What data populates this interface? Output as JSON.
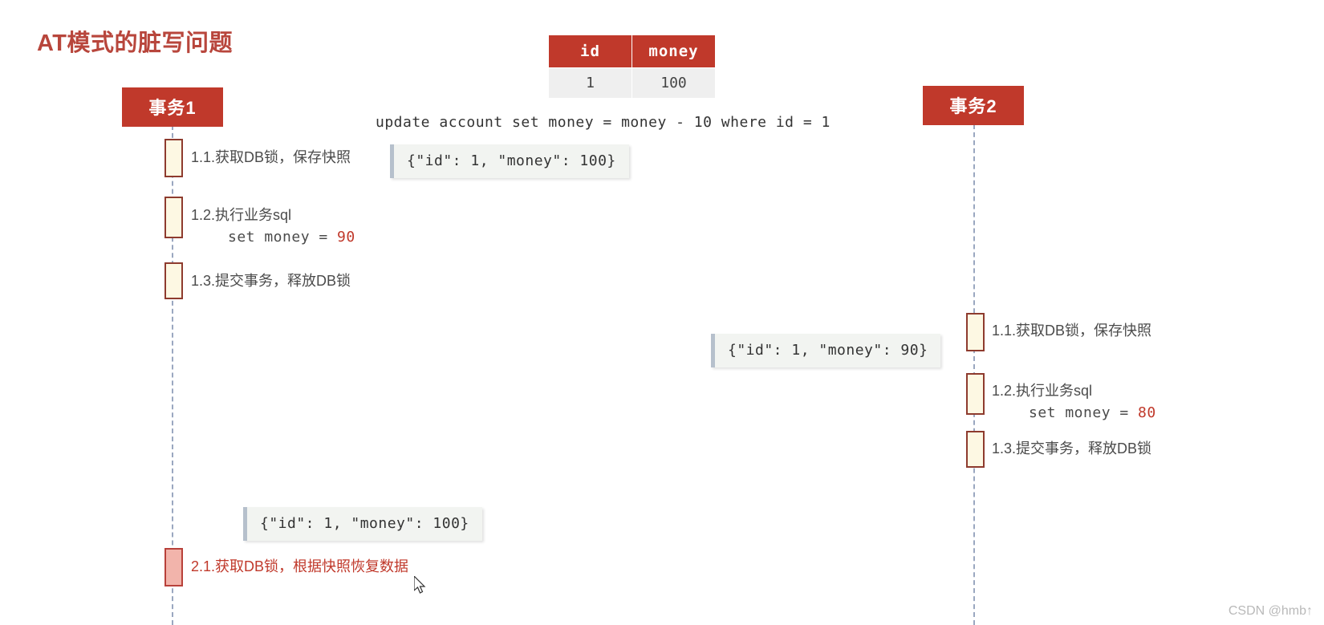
{
  "page": {
    "title": "AT模式的脏写问题",
    "title_color": "#b8463c",
    "background": "#ffffff",
    "watermark": "CSDN @hmb↑"
  },
  "table": {
    "headers": [
      "id",
      "money"
    ],
    "rows": [
      [
        "1",
        "100"
      ]
    ],
    "header_bg": "#c0392b",
    "row_bg": "#efefef"
  },
  "sql": {
    "statement": "update account set money = money - 10 where id = 1"
  },
  "participants": [
    {
      "name": "事务1",
      "label": "事务1"
    },
    {
      "name": "事务2",
      "label": "事务2"
    }
  ],
  "tx1_steps": [
    {
      "id": "1.1",
      "text": "1.1.获取DB锁，保存快照",
      "detail": "",
      "detail_value": ""
    },
    {
      "id": "1.2",
      "text": "1.2.执行业务sql",
      "detail": "set money = ",
      "detail_value": "90"
    },
    {
      "id": "1.3",
      "text": "1.3.提交事务，释放DB锁",
      "detail": "",
      "detail_value": ""
    },
    {
      "id": "2.1",
      "text": "2.1.获取DB锁，根据快照恢复数据",
      "detail": "",
      "detail_value": ""
    }
  ],
  "tx2_steps": [
    {
      "id": "1.1",
      "text": "1.1.获取DB锁，保存快照",
      "detail": "",
      "detail_value": ""
    },
    {
      "id": "1.2",
      "text": "1.2.执行业务sql",
      "detail": "set money = ",
      "detail_value": "80"
    },
    {
      "id": "1.3",
      "text": "1.3.提交事务，释放DB锁",
      "detail": "",
      "detail_value": ""
    }
  ],
  "snapshots": [
    {
      "name": "snapshot-tx1-before",
      "text": "{\"id\": 1, \"money\": 100}"
    },
    {
      "name": "snapshot-tx2-before",
      "text": "{\"id\": 1, \"money\": 90}"
    },
    {
      "name": "snapshot-tx1-rollback",
      "text": "{\"id\": 1, \"money\": 100}"
    }
  ],
  "colors": {
    "accent_red": "#c0392b",
    "activation_fill": "#fdf8e3",
    "activation_border": "#8e3b2e",
    "rollback_fill": "#f2b4ab",
    "lifeline": "#9aa7c0",
    "note_bg": "#f2f4f1"
  }
}
